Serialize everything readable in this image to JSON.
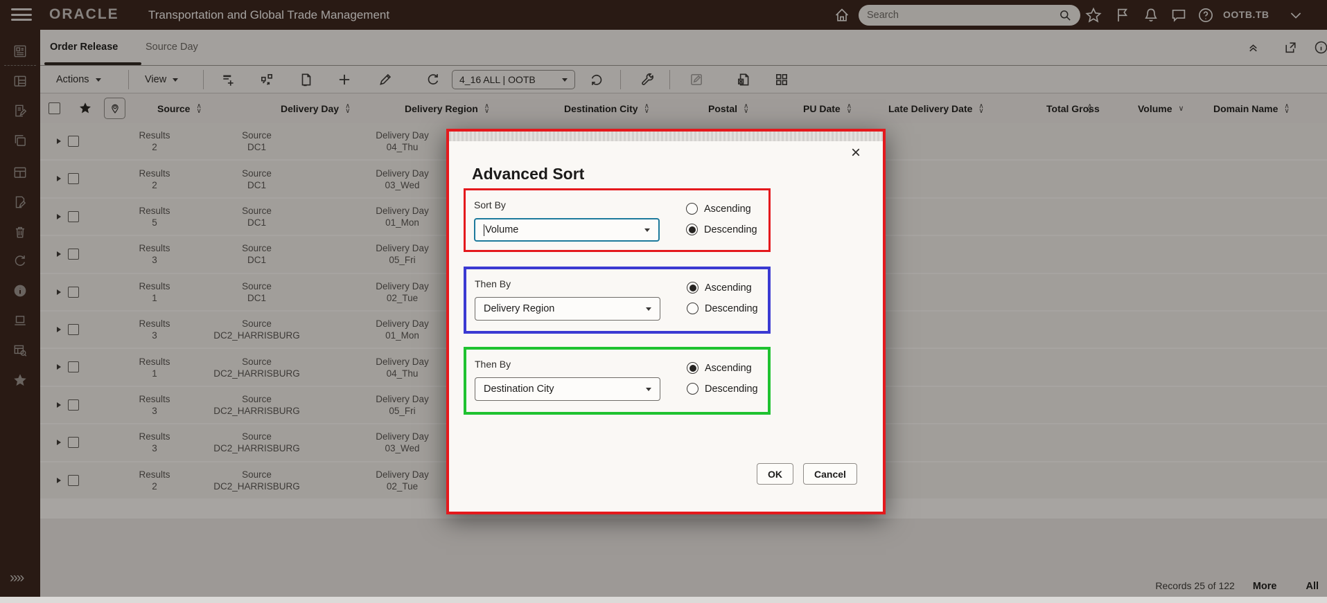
{
  "topbar": {
    "brand": "ORACLE",
    "app_title": "Transportation and Global Trade Management",
    "search_placeholder": "Search",
    "user_menu": "OOTB.TB"
  },
  "tabs": {
    "order_release": "Order Release",
    "source_day": "Source Day"
  },
  "toolbar": {
    "actions_label": "Actions",
    "view_label": "View",
    "saved_search_value": "4_16 ALL | OOTB"
  },
  "table": {
    "columns": [
      "Source",
      "Delivery Day",
      "Delivery Region",
      "Destination City",
      "Postal",
      "PU Date",
      "Late Delivery Date",
      "Total Gross",
      "Volume",
      "Domain Name"
    ],
    "row_labels": {
      "results": "Results",
      "source": "Source",
      "delivery_day": "Delivery Day"
    },
    "rows": [
      {
        "results": "2",
        "source": "DC1",
        "delivery_day": "04_Thu"
      },
      {
        "results": "2",
        "source": "DC1",
        "delivery_day": "03_Wed"
      },
      {
        "results": "5",
        "source": "DC1",
        "delivery_day": "01_Mon"
      },
      {
        "results": "3",
        "source": "DC1",
        "delivery_day": "05_Fri"
      },
      {
        "results": "1",
        "source": "DC1",
        "delivery_day": "02_Tue"
      },
      {
        "results": "3",
        "source": "DC2_HARRISBURG",
        "delivery_day": "01_Mon"
      },
      {
        "results": "1",
        "source": "DC2_HARRISBURG",
        "delivery_day": "04_Thu"
      },
      {
        "results": "3",
        "source": "DC2_HARRISBURG",
        "delivery_day": "05_Fri"
      },
      {
        "results": "3",
        "source": "DC2_HARRISBURG",
        "delivery_day": "03_Wed"
      },
      {
        "results": "2",
        "source": "DC2_HARRISBURG",
        "delivery_day": "02_Tue"
      }
    ]
  },
  "modal": {
    "title": "Advanced Sort",
    "close_glyph": "×",
    "sections": [
      {
        "label": "Sort By",
        "value": "Volume",
        "direction": "Descending"
      },
      {
        "label": "Then By",
        "value": "Delivery Region",
        "direction": "Ascending"
      },
      {
        "label": "Then By",
        "value": "Destination City",
        "direction": "Ascending"
      }
    ],
    "radio_options": {
      "ascending": "Ascending",
      "descending": "Descending"
    },
    "ok_label": "OK",
    "cancel_label": "Cancel",
    "annotation_colors": {
      "modal_outline": "#e4191d",
      "sort_by_box": "#e4191d",
      "then_by_box_1": "#3b3ad2",
      "then_by_box_2": "#1fc230"
    }
  },
  "footer": {
    "records": "Records 25 of 122",
    "more_label": "More",
    "all_label": "All"
  },
  "icons": {
    "topbar": [
      "hamburger-menu-icon",
      "home-icon",
      "search-icon",
      "favorites-star-icon",
      "flag-icon",
      "notifications-bell-icon",
      "chat-icon",
      "help-icon",
      "chevron-down-icon"
    ],
    "tabbar": [
      "collapse-up-icon",
      "open-in-new-icon",
      "info-icon"
    ],
    "toolbar": [
      "list-add-icon",
      "swap-boxes-icon",
      "document-remove-icon",
      "add-icon",
      "edit-pencil-icon",
      "refresh-icon",
      "reload-icon",
      "wrench-icon",
      "mass-edit-icon",
      "export-document-icon",
      "grid-view-icon"
    ],
    "sidebar": [
      "workbench-icon",
      "layout-panel-icon",
      "document-edit-icon",
      "copy-icon",
      "window-layout-icon",
      "file-edit-icon",
      "trash-icon",
      "refresh-icon",
      "info-filled-icon",
      "laptop-icon",
      "table-search-icon",
      "star-filled-icon",
      "expand-sidebar-icon"
    ]
  }
}
